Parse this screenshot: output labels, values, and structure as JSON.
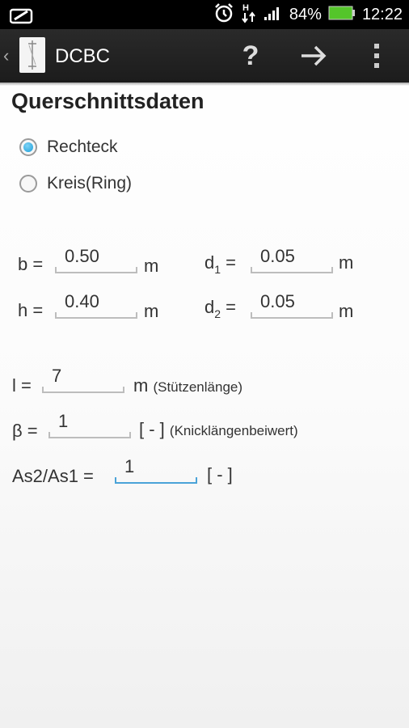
{
  "status_bar": {
    "battery_percent": "84%",
    "time": "12:22",
    "colors": {
      "battery": "#54c52a"
    }
  },
  "action_bar": {
    "title": "DCBC",
    "help_label": "?"
  },
  "section": {
    "title": "Querschnittsdaten"
  },
  "shape_options": [
    {
      "label": "Rechteck",
      "selected": true
    },
    {
      "label": "Kreis(Ring)",
      "selected": false
    }
  ],
  "dimensions": {
    "b": {
      "label": "b =",
      "value": "0.50",
      "unit": "m"
    },
    "h": {
      "label": "h =",
      "value": "0.40",
      "unit": "m"
    },
    "d1": {
      "label": "d",
      "sub": "1",
      "eq": "=",
      "value": "0.05",
      "unit": "m"
    },
    "d2": {
      "label": "d",
      "sub": "2",
      "eq": "=",
      "value": "0.05",
      "unit": "m"
    }
  },
  "params": {
    "l": {
      "label": "l =",
      "value": "7",
      "unit": "m",
      "note": "(Stützenlänge)"
    },
    "beta": {
      "label": "β =",
      "value": "1",
      "unit": "[ - ]",
      "note": "(Knicklängenbeiwert)"
    },
    "as_ratio": {
      "label": "As2/As1 =",
      "value": "1",
      "unit": "[ - ]"
    }
  },
  "accent_color": "#1a9ed9"
}
